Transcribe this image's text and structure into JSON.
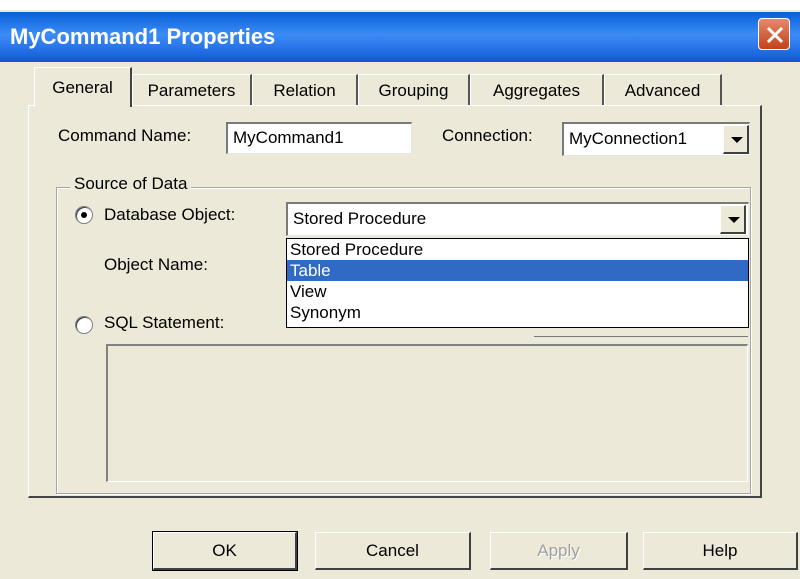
{
  "window": {
    "title": "MyCommand1 Properties"
  },
  "tabs": [
    {
      "label": "General",
      "active": true
    },
    {
      "label": "Parameters",
      "active": false
    },
    {
      "label": "Relation",
      "active": false
    },
    {
      "label": "Grouping",
      "active": false
    },
    {
      "label": "Aggregates",
      "active": false
    },
    {
      "label": "Advanced",
      "active": false
    }
  ],
  "general": {
    "command_name_label": "Command Name:",
    "command_name_value": "MyCommand1",
    "connection_label": "Connection:",
    "connection_value": "MyConnection1",
    "source_group_title": "Source of Data",
    "database_object_label": "Database Object:",
    "database_object_value": "Stored Procedure",
    "object_name_label": "Object Name:",
    "sql_statement_label": "SQL Statement:",
    "dropdown_options": [
      "Stored Procedure",
      "Table",
      "View",
      "Synonym"
    ],
    "dropdown_highlighted": "Table"
  },
  "buttons": {
    "ok": "OK",
    "cancel": "Cancel",
    "apply": "Apply",
    "help": "Help"
  },
  "colors": {
    "title_bar": "#2a75ea",
    "selection": "#316ac5",
    "close": "#c3411a",
    "face": "#ece9d8"
  }
}
